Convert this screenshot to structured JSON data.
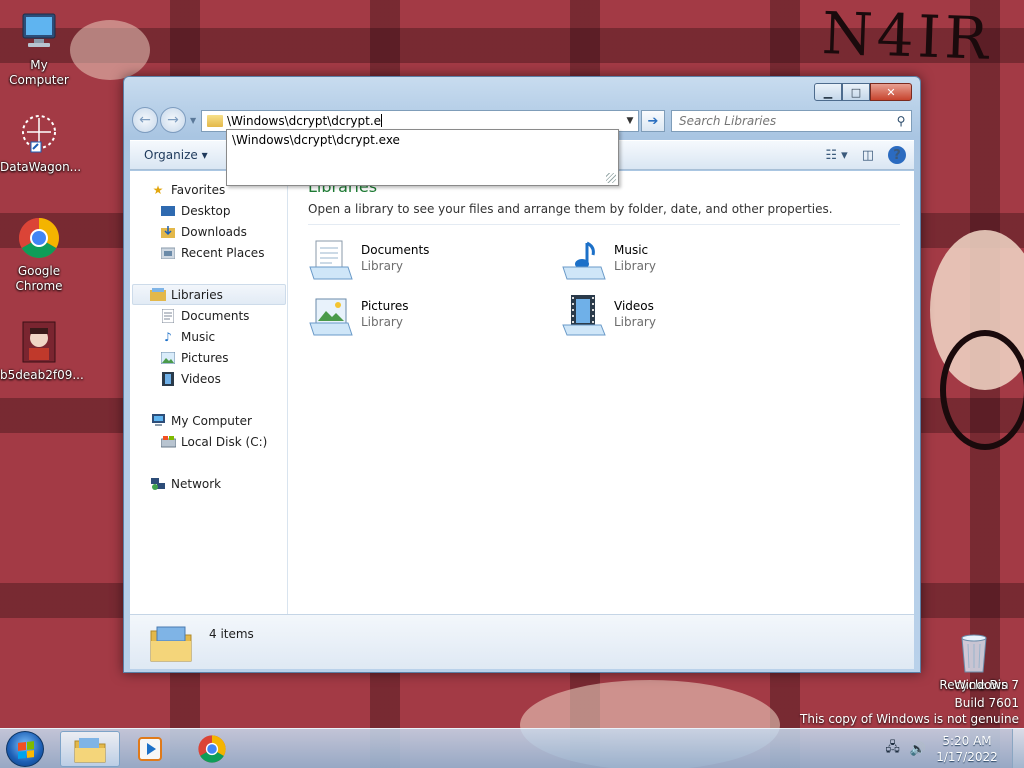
{
  "desktop": {
    "deco_text": "N4IR",
    "icons": [
      {
        "label": "My Computer",
        "name": "my-computer"
      },
      {
        "label": "DataWagon...",
        "name": "datawagon"
      },
      {
        "label": "Google Chrome",
        "name": "google-chrome"
      },
      {
        "label": "b5deab2f09...",
        "name": "image-file"
      }
    ],
    "recycle_bin": "Recycle Bin",
    "watermark": {
      "line1": "Windows 7",
      "line2": "Build 7601",
      "line3": "This copy of Windows is not genuine"
    }
  },
  "window": {
    "address_value": "\\Windows\\dcrypt\\dcrypt.e",
    "search_placeholder": "Search Libraries",
    "organize_label": "Organize",
    "autocomplete": [
      "\\Windows\\dcrypt\\dcrypt.exe"
    ],
    "nav": {
      "favorites": "Favorites",
      "favorites_items": [
        "Desktop",
        "Downloads",
        "Recent Places"
      ],
      "libraries": "Libraries",
      "libraries_items": [
        "Documents",
        "Music",
        "Pictures",
        "Videos"
      ],
      "computer": "My Computer",
      "computer_items": [
        "Local Disk (C:)"
      ],
      "network": "Network"
    },
    "content": {
      "title": "Libraries",
      "description": "Open a library to see your files and arrange them by folder, date, and other properties.",
      "libraries": [
        {
          "name": "Documents",
          "type": "Library"
        },
        {
          "name": "Music",
          "type": "Library"
        },
        {
          "name": "Pictures",
          "type": "Library"
        },
        {
          "name": "Videos",
          "type": "Library"
        }
      ]
    },
    "status": {
      "count": "4 items"
    }
  },
  "taskbar": {
    "time": "5:20 AM",
    "date": "1/17/2022"
  },
  "colors": {
    "desktop_bg": "#a33a45",
    "library_title": "#1e7b34",
    "link_text": "#1e395b"
  }
}
